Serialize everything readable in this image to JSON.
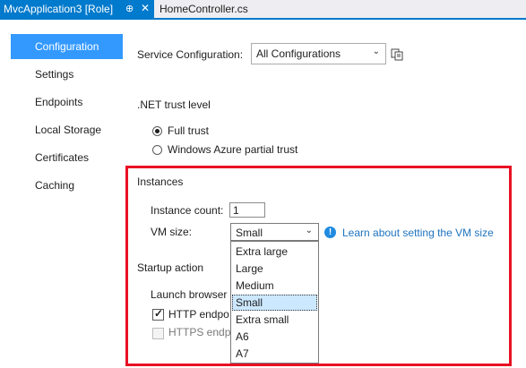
{
  "tabs": {
    "active_title": "MvcApplication3 [Role]",
    "pin_glyph": "⊕",
    "close_glyph": "✕",
    "inactive_title": "HomeController.cs"
  },
  "nav": {
    "items": [
      "Configuration",
      "Settings",
      "Endpoints",
      "Local Storage",
      "Certificates",
      "Caching"
    ],
    "selected": "Configuration"
  },
  "service_configuration": {
    "label": "Service Configuration:",
    "value": "All Configurations"
  },
  "trust": {
    "heading": ".NET trust level",
    "full_trust": "Full trust",
    "partial_trust": "Windows Azure partial trust"
  },
  "instances": {
    "heading": "Instances",
    "count_label": "Instance count:",
    "count_value": "1",
    "vm_size_label": "VM size:",
    "vm_size_value": "Small",
    "info_glyph": "!",
    "learn_link": "Learn about setting the VM size",
    "vm_options": [
      "Extra large",
      "Large",
      "Medium",
      "Small",
      "Extra small",
      "A6",
      "A7"
    ]
  },
  "startup": {
    "heading": "Startup action",
    "launch_browser_label": "Launch browser",
    "http_label": "HTTP endpo",
    "https_label": "HTTPS endp"
  },
  "colors": {
    "accent": "#007acc",
    "nav_selected": "#3399ff",
    "highlight": "#e81123",
    "link": "#1e73be"
  }
}
